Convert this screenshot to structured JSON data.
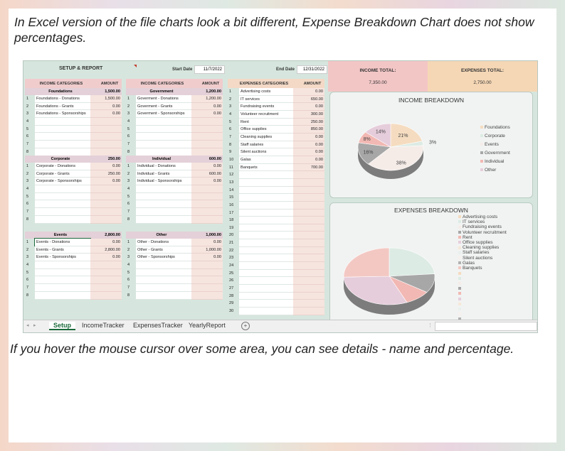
{
  "captions": {
    "top": "In  Excel version of the file charts look a bit different, Expense Breakdown Chart does not show percentages.",
    "bottom": "If you hover the mouse cursor over some area, you can see details - name and percentage."
  },
  "sheet": {
    "title": "SETUP & REPORT",
    "start_label": "Start Date",
    "start_date": "11/7/2022",
    "end_label": "End Date",
    "end_date": "12/31/2022",
    "income_total_label": "INCOME TOTAL:",
    "income_total": "7,350.00",
    "expenses_total_label": "EXPENSES TOTAL:",
    "expenses_total": "2,750.00",
    "col_income": "INCOME CATEGORIES",
    "col_expenses": "EXPENSES CATEGORIES",
    "col_amount": "AMOUNT",
    "groups": [
      {
        "name": "Foundations",
        "total": "1,500.00",
        "rows": [
          [
            "Foundations - Donations",
            "1,500.00"
          ],
          [
            "Foundations - Grants",
            "0.00"
          ],
          [
            "Foundations - Sponsorships",
            "0.00"
          ],
          [
            "",
            ""
          ],
          [
            "",
            ""
          ],
          [
            "",
            ""
          ],
          [
            "",
            ""
          ],
          [
            "",
            ""
          ]
        ]
      },
      {
        "name": "Government",
        "total": "1,200.00",
        "rows": [
          [
            "Goverment - Donations",
            "1,200.00"
          ],
          [
            "Goverment - Grants",
            "0.00"
          ],
          [
            "Goverment - Sponsorships",
            "0.00"
          ],
          [
            "",
            ""
          ],
          [
            "",
            ""
          ],
          [
            "",
            ""
          ],
          [
            "",
            ""
          ],
          [
            "",
            ""
          ]
        ]
      },
      {
        "name": "Corporate",
        "total": "250.00",
        "rows": [
          [
            "Corporate - Donations",
            "0.00"
          ],
          [
            "Corporate - Grants",
            "250.00"
          ],
          [
            "Corporate - Sponsorships",
            "0.00"
          ],
          [
            "",
            ""
          ],
          [
            "",
            ""
          ],
          [
            "",
            ""
          ],
          [
            "",
            ""
          ],
          [
            "",
            ""
          ]
        ]
      },
      {
        "name": "Individual",
        "total": "600.00",
        "rows": [
          [
            "Individual - Donations",
            "0.00"
          ],
          [
            "Individual - Grants",
            "600.00"
          ],
          [
            "Individual - Sponsorships",
            "0.00"
          ],
          [
            "",
            ""
          ],
          [
            "",
            ""
          ],
          [
            "",
            ""
          ],
          [
            "",
            ""
          ],
          [
            "",
            ""
          ]
        ]
      },
      {
        "name": "Events",
        "total": "2,800.00",
        "rows": [
          [
            "Events - Donations",
            "0.00"
          ],
          [
            "Events - Grants",
            "2,800.00"
          ],
          [
            "Events - Sponsorships",
            "0.00"
          ],
          [
            "",
            ""
          ],
          [
            "",
            ""
          ],
          [
            "",
            ""
          ],
          [
            "",
            ""
          ],
          [
            "",
            ""
          ]
        ]
      },
      {
        "name": "Other",
        "total": "1,000.00",
        "rows": [
          [
            "Other - Donations",
            "0.00"
          ],
          [
            "Other - Grants",
            "1,000.00"
          ],
          [
            "Other - Sponsorships",
            "0.00"
          ],
          [
            "",
            ""
          ],
          [
            "",
            ""
          ],
          [
            "",
            ""
          ],
          [
            "",
            ""
          ],
          [
            "",
            ""
          ]
        ]
      }
    ],
    "expenses": [
      [
        "Advertising costs",
        "0.00"
      ],
      [
        "IT services",
        "650.00"
      ],
      [
        "Fundraising events",
        "0.00"
      ],
      [
        "Volunteer recruitment",
        "300.00"
      ],
      [
        "Rent",
        "250.00"
      ],
      [
        "Office supplies",
        "850.00"
      ],
      [
        "Cleaning supplies",
        "0.00"
      ],
      [
        "Staff salaries",
        "0.00"
      ],
      [
        "Silent auctions",
        "0.00"
      ],
      [
        "Galas",
        "0.00"
      ],
      [
        "Banquets",
        "700.00"
      ],
      [
        "",
        ""
      ],
      [
        "",
        ""
      ],
      [
        "",
        ""
      ],
      [
        "",
        ""
      ],
      [
        "",
        ""
      ],
      [
        "",
        ""
      ],
      [
        "",
        ""
      ],
      [
        "",
        ""
      ],
      [
        "",
        ""
      ],
      [
        "",
        ""
      ],
      [
        "",
        ""
      ],
      [
        "",
        ""
      ],
      [
        "",
        ""
      ],
      [
        "",
        ""
      ],
      [
        "",
        ""
      ],
      [
        "",
        ""
      ],
      [
        "",
        ""
      ],
      [
        "",
        ""
      ],
      [
        "",
        ""
      ]
    ],
    "tabs": [
      "Setup",
      "IncomeTracker",
      "ExpensesTracker",
      "YearlyReport"
    ]
  },
  "chart_data": [
    {
      "type": "pie",
      "title": "INCOME BREAKDOWN",
      "categories": [
        "Foundations",
        "Corporate",
        "Events",
        "Government",
        "Individual",
        "Other"
      ],
      "values": [
        21,
        3,
        38,
        16,
        8,
        14
      ],
      "labels": [
        "21%",
        "3%",
        "38%",
        "16%",
        "8%",
        "14%"
      ],
      "colors": [
        "#f5dcc0",
        "#dcebe4",
        "#f5ece8",
        "#a7a7a7",
        "#f2b8b3",
        "#e6cddb"
      ],
      "legend": "right"
    },
    {
      "type": "pie",
      "title": "EXPENSES BREAKDOWN",
      "categories": [
        "Advertising costs",
        "IT services",
        "Fundraising events",
        "Volunteer recruitment",
        "Rent",
        "Office supplies",
        "Cleaning supplies",
        "Staff salaries",
        "Silent auctions",
        "Galas",
        "Banquets"
      ],
      "values": [
        0,
        650,
        0,
        300,
        250,
        850,
        0,
        0,
        0,
        0,
        700
      ],
      "colors": [
        "#f5dcc0",
        "#dcebe4",
        "#f5ece8",
        "#a7a7a7",
        "#f2b8b3",
        "#e6cddb",
        "#f6e8d8",
        "#e8efec",
        "#f7f0ec",
        "#b0b0b0",
        "#f3c8c3"
      ],
      "legend": "right"
    }
  ]
}
